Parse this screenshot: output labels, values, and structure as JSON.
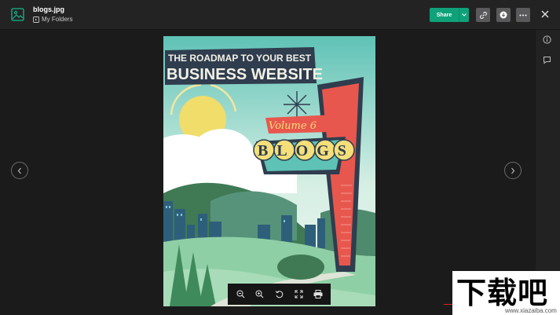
{
  "header": {
    "file_name": "blogs.jpg",
    "folder_label": "My Folders",
    "share_label": "Share"
  },
  "poster": {
    "headline_line1": "THE ROADMAP TO YOUR BEST",
    "headline_line2": "BUSINESS WEBSITE",
    "volume_text": "Volume 6",
    "sign_text": "BLOGS"
  },
  "watermark": {
    "text": "下载吧",
    "site": "www.xiazaiba.com"
  },
  "colors": {
    "share_green": "#0fa27a",
    "sign_red": "#e8574d",
    "sky": "#cfeee0",
    "hill_green": "#3f7a55"
  }
}
